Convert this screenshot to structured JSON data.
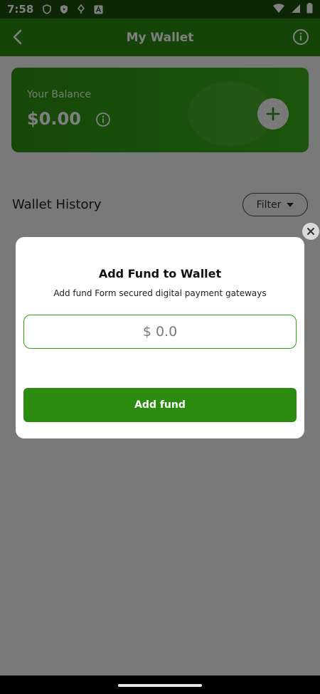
{
  "status_bar": {
    "time": "7:58",
    "left_icons": [
      "shield-icon",
      "play-shield-icon",
      "location-icon",
      "a-icon"
    ],
    "right_icons": [
      "wifi-icon",
      "signal-icon",
      "battery-icon"
    ]
  },
  "app_bar": {
    "title": "My Wallet",
    "back_icon": "chevron-left-icon",
    "info_icon": "info-icon"
  },
  "balance_card": {
    "label": "Your Balance",
    "amount": "$0.00",
    "info_icon": "info-icon",
    "add_icon": "plus-icon"
  },
  "history": {
    "title": "Wallet History",
    "filter_label": "Filter",
    "filter_icon": "caret-down-icon"
  },
  "modal": {
    "title": "Add Fund to Wallet",
    "subtitle": "Add fund Form secured digital payment gateways",
    "amount_placeholder": "$ 0.0",
    "submit_label": "Add fund",
    "close_icon": "close-icon"
  },
  "colors": {
    "brand_green": "#29880f",
    "card_green": "#33a315",
    "button_green": "#2c8c10"
  }
}
